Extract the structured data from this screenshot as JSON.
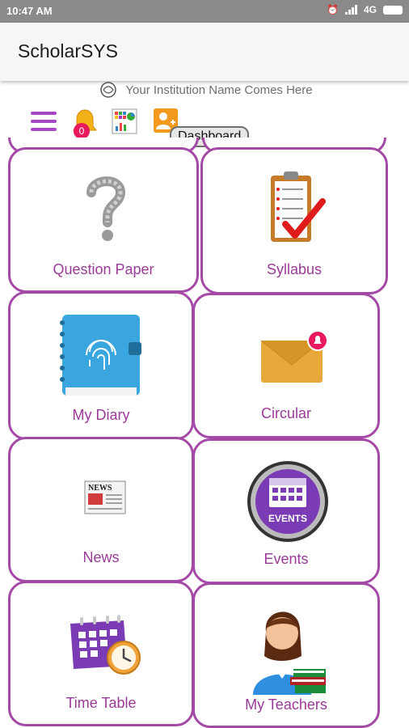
{
  "status_bar": {
    "time": "10:47 AM",
    "network": "4G"
  },
  "app_bar": {
    "title": "ScholarSYS"
  },
  "institution": {
    "name": "Your Institution Name Comes Here"
  },
  "toolbar": {
    "notification_count": "0",
    "tooltip": "Dashboard"
  },
  "tiles": [
    {
      "label": "Question Paper",
      "icon": "question-mark-icon"
    },
    {
      "label": "Syllabus",
      "icon": "checklist-clipboard-icon"
    },
    {
      "label": "My Diary",
      "icon": "diary-icon"
    },
    {
      "label": "Circular",
      "icon": "envelope-icon"
    },
    {
      "label": "News",
      "icon": "newspaper-icon"
    },
    {
      "label": "Events",
      "icon": "events-calendar-icon"
    },
    {
      "label": "Time Table",
      "icon": "calendar-clock-icon"
    },
    {
      "label": "My Teachers",
      "icon": "teacher-icon"
    }
  ],
  "colors": {
    "accent": "#a44aa6",
    "label": "#9a3a98",
    "badge": "#e8195e",
    "status_bar": "#8a8a8a"
  }
}
